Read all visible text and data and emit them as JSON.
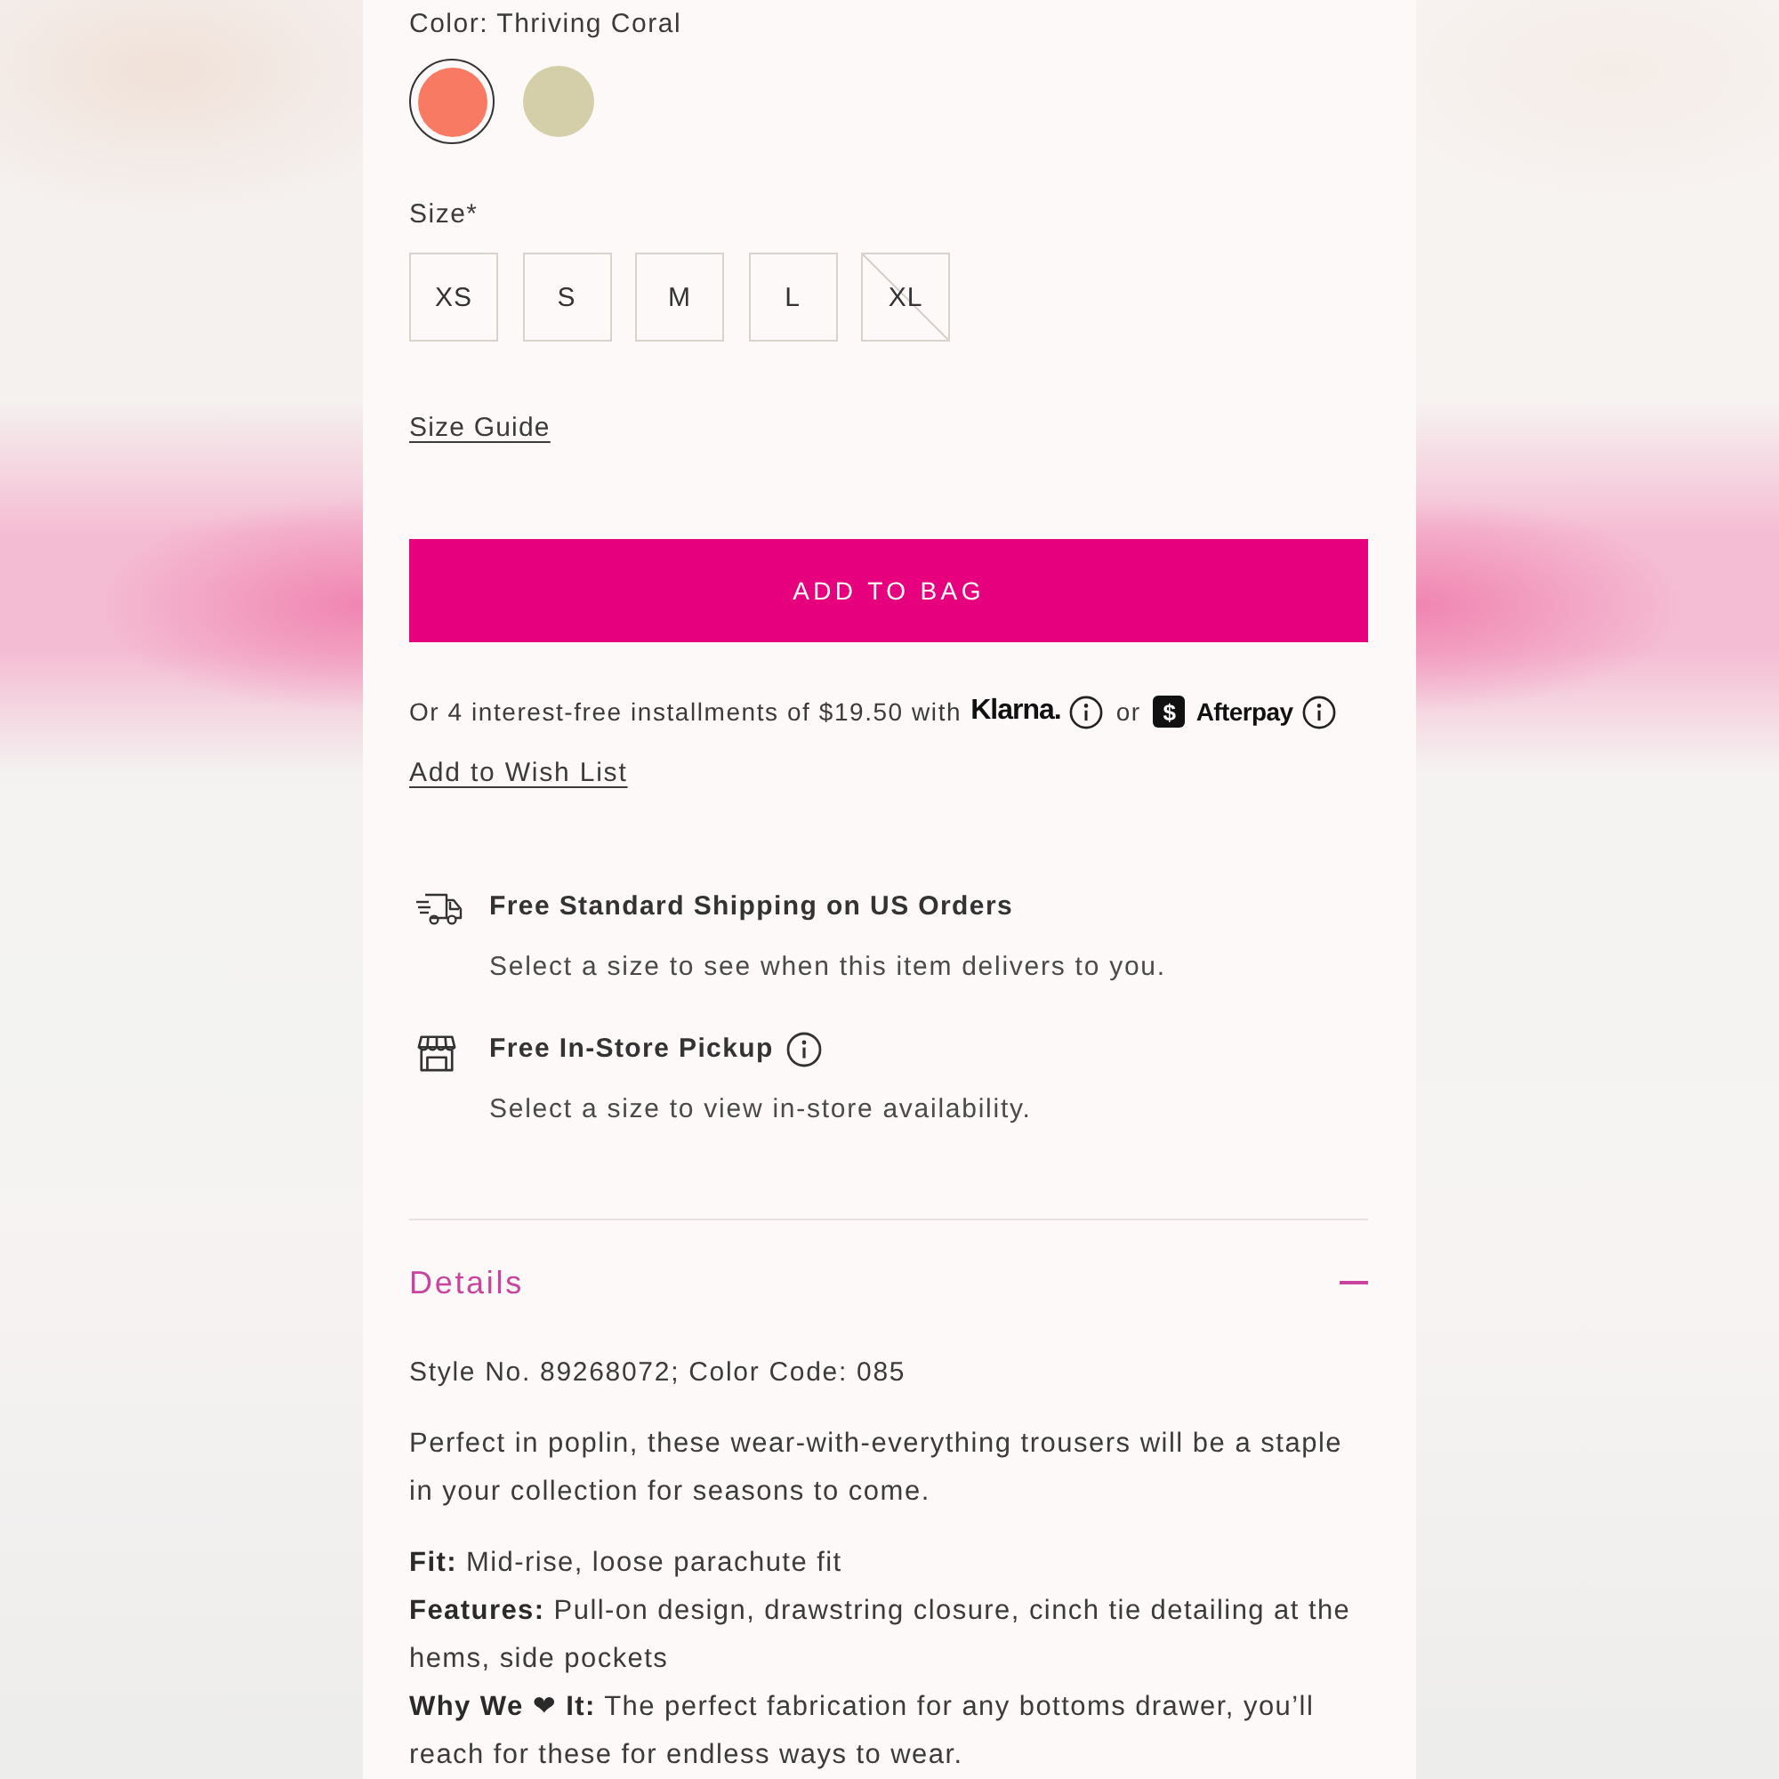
{
  "color_picker": {
    "label": "Color: Thriving Coral",
    "swatches": [
      {
        "color": "#f97a62",
        "selected": true
      },
      {
        "color": "#d4cea9",
        "selected": false
      }
    ]
  },
  "size_picker": {
    "label": "Size*",
    "options": [
      {
        "label": "XS",
        "available": true
      },
      {
        "label": "S",
        "available": true
      },
      {
        "label": "M",
        "available": true
      },
      {
        "label": "L",
        "available": true
      },
      {
        "label": "XL",
        "available": false
      }
    ]
  },
  "size_guide_link": "Size Guide",
  "add_to_bag_button": "ADD TO BAG",
  "installments": {
    "text": "Or 4 interest-free installments of $19.50 with",
    "klarna": "Klarna.",
    "separator": "or",
    "afterpay_badge": "$",
    "afterpay": "Afterpay"
  },
  "wish_list_link": "Add to Wish List",
  "fulfillment": [
    {
      "kind": "shipping",
      "title": "Free Standard Shipping on US Orders",
      "info": false,
      "note": "Select a size to see when this item delivers to you."
    },
    {
      "kind": "pickup",
      "title": "Free In-Store Pickup",
      "info": true,
      "note": "Select a size to view in-store availability."
    }
  ],
  "details": {
    "title": "Details",
    "expanded": true,
    "style_line": "Style No. 89268072; Color Code: 085",
    "description": "Perfect in poplin, these wear-with-everything trousers will be a staple in your collection for seasons to come.",
    "specs": [
      "**Fit:** Mid-rise, loose parachute fit",
      "**Features:** Pull-on design, drawstring closure, cinch tie detailing at the hems, side pockets",
      "**Why We ❤ It:** The perfect fabrication for any bottoms drawer, you’ll reach for these for endless ways to wear."
    ]
  }
}
